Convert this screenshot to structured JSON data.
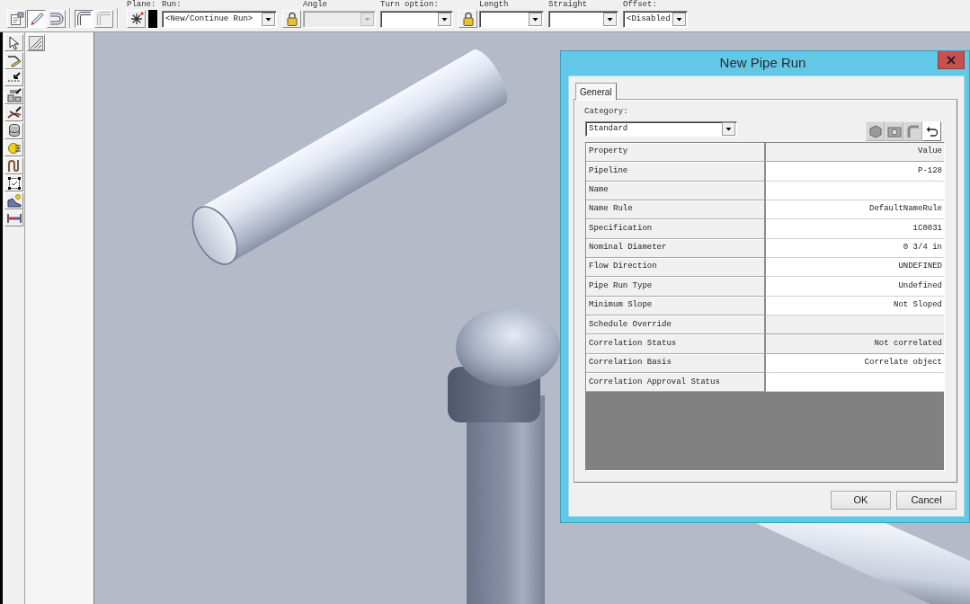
{
  "toolbar": {
    "mode_buttons": [
      {
        "pressed": false,
        "disabled": false
      },
      {
        "pressed": true,
        "disabled": false
      },
      {
        "pressed": false,
        "disabled": false
      },
      {
        "pressed": true,
        "disabled": false
      },
      {
        "pressed": false,
        "disabled": true
      }
    ],
    "fields": [
      {
        "kind": "plane",
        "label": "Plane:"
      },
      {
        "kind": "select",
        "label": "Run:",
        "value": "<New/Continue Run>",
        "lock": false,
        "disabled": false
      },
      {
        "kind": "select",
        "label": "Angle",
        "lock": true,
        "disabled": true
      },
      {
        "kind": "select",
        "label": "Turn option:",
        "lock": false,
        "disabled": false
      },
      {
        "kind": "select",
        "label": "Length",
        "lock": true,
        "disabled": false
      },
      {
        "kind": "select",
        "label": "Straight",
        "lock": false,
        "disabled": false
      },
      {
        "kind": "select",
        "label": "Offset:",
        "value": "<Disabled",
        "lock": false,
        "disabled": false
      }
    ]
  },
  "dialog": {
    "title": "New Pipe Run",
    "tabs": [
      {
        "label": "General",
        "selected": true
      }
    ],
    "category": {
      "label": "Category:",
      "value": "Standard"
    },
    "view_buttons": [
      {
        "disabled": true
      },
      {
        "disabled": true
      },
      {
        "disabled": true
      },
      {
        "disabled": false
      }
    ],
    "grid": {
      "columns": [
        "Property",
        "Value"
      ],
      "rows": [
        {
          "property": "Pipeline",
          "value": "P-128",
          "read_only": false
        },
        {
          "property": "Name",
          "read_only": false
        },
        {
          "property": "Name Rule",
          "value": "DefaultNameRule",
          "read_only": false
        },
        {
          "property": "Specification",
          "value": "1C0031",
          "read_only": false
        },
        {
          "property": "Nominal Diameter",
          "value": "0 3/4 in",
          "read_only": false
        },
        {
          "property": "Flow Direction",
          "value": "UNDEFINED",
          "read_only": false
        },
        {
          "property": "Pipe Run Type",
          "value": "Undefined",
          "read_only": false
        },
        {
          "property": "Minimum Slope",
          "value": "Not Sloped",
          "read_only": false
        },
        {
          "property": "Schedule Override",
          "read_only": true
        },
        {
          "property": "Correlation Status",
          "value": "Not correlated",
          "read_only": true
        },
        {
          "property": "Correlation Basis",
          "value": "Correlate object",
          "read_only": false
        },
        {
          "property": "Correlation Approval Status",
          "read_only": false
        }
      ]
    },
    "buttons": [
      "OK",
      "Cancel"
    ]
  }
}
